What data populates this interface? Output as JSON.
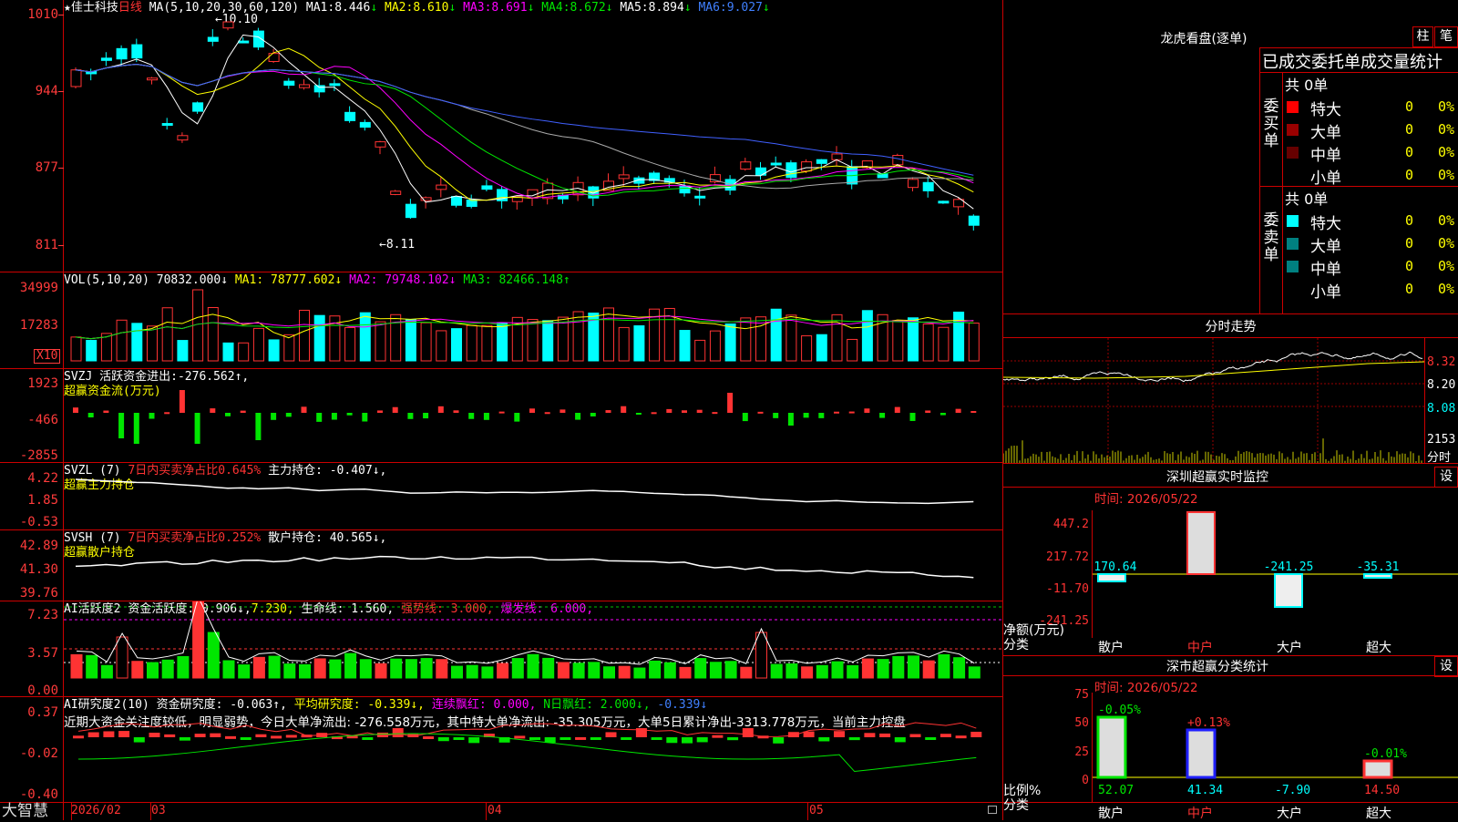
{
  "colors": {
    "up": "#ff3333",
    "down": "#00ffff",
    "bg": "#000000",
    "grid": "#cc0000"
  },
  "kline": {
    "stock": "佳士科技",
    "period": "日线",
    "ma_label": "MA(5,10,20,30,60,120)",
    "ma": [
      {
        "name": "MA1:",
        "value": "8.446",
        "arrow": "↓"
      },
      {
        "name": "MA2:",
        "value": "8.610",
        "arrow": "↓"
      },
      {
        "name": "MA3:",
        "value": "8.691",
        "arrow": "↓"
      },
      {
        "name": "MA4:",
        "value": "8.672",
        "arrow": "↓"
      },
      {
        "name": "MA5:",
        "value": "8.894",
        "arrow": "↓"
      },
      {
        "name": "MA6:",
        "value": "9.027",
        "arrow": "↓"
      }
    ],
    "y_labels": [
      "1010",
      "944",
      "877",
      "811"
    ],
    "high_note": "10.10",
    "low_note": "8.11"
  },
  "vol": {
    "title": "VOL(5,10,20)",
    "value": "70832.000↓",
    "ma1": "MA1: 78777.602↓",
    "ma2": "MA2: 79748.102↓",
    "ma3": "MA3: 82466.148↑",
    "y_labels": [
      "34999",
      "17283"
    ],
    "unit": "X10"
  },
  "svzj": {
    "line1": "SVZJ  活跃资金进出:",
    "value": "-276.562↑,",
    "sub": "超赢资金流(万元)",
    "y_labels": [
      "1923",
      "-466",
      "-2855"
    ]
  },
  "svzl": {
    "label": "SVZL (7)",
    "ratio": "7日内买卖净占比0.645%",
    "main": "主力持仓: -0.407↓,",
    "sub": "超赢主力持仓",
    "y_labels": [
      "4.22",
      "1.85",
      "-0.53"
    ]
  },
  "svsh": {
    "label": "SVSH (7)",
    "ratio": "7日内买卖净占比0.252%",
    "main": "散户持仓: 40.565↓,",
    "sub": "超赢散户持仓",
    "y_labels": [
      "42.89",
      "41.30",
      "39.76"
    ]
  },
  "ai_active": {
    "label": "AI活跃度2",
    "a": "资金活跃度: 0.906↓,",
    "b": "7.230,",
    "c": "生命线: 1.560,",
    "d": "强势线: 3.000,",
    "e": "爆发线: 6.000,",
    "y_labels": [
      "7.23",
      "3.57",
      "0.00"
    ]
  },
  "ai_research": {
    "label": "AI研究度2(10)",
    "a": "资金研究度: -0.063↑,",
    "b": "平均研究度: -0.339↓,",
    "c": "连续飘红: 0.000,",
    "d": "N日飘红: 2.000↓,",
    "e": "-0.339↓",
    "comment": "近期大资金关注度较低，明显弱势，今日大单净流出: -276.558万元，其中特大单净流出: -35.305万元，大单5日累计净出-3313.778万元，当前主力控盘",
    "y_labels": [
      "0.37",
      "-0.02",
      "-0.40"
    ]
  },
  "x_axis": {
    "brand": "大智慧",
    "labels": [
      "2026/02",
      "03",
      "04",
      "05"
    ]
  },
  "right": {
    "lhb_title": "龙虎看盘(逐单)",
    "btn1": "柱",
    "btn2": "笔",
    "order_title": "已成交委托单成交量统计",
    "buy_label": "委买单",
    "sell_label": "委卖单",
    "buy_total": "共 0单",
    "sell_total": "共 0单",
    "buy_rows": [
      {
        "name": "特大",
        "count": "0",
        "pct": "0%",
        "color": "#ff0000"
      },
      {
        "name": "大单",
        "count": "0",
        "pct": "0%",
        "color": "#990000"
      },
      {
        "name": "中单",
        "count": "0",
        "pct": "0%",
        "color": "#660000"
      },
      {
        "name": "小单",
        "count": "0",
        "pct": "0%",
        "color": ""
      }
    ],
    "sell_rows": [
      {
        "name": "特大",
        "count": "0",
        "pct": "0%",
        "color": "#00ffff"
      },
      {
        "name": "大单",
        "count": "0",
        "pct": "0%",
        "color": "#008080"
      },
      {
        "name": "中单",
        "count": "0",
        "pct": "0%",
        "color": "#008080"
      },
      {
        "name": "小单",
        "count": "0",
        "pct": "0%",
        "color": ""
      }
    ],
    "intraday_title": "分时走势",
    "intraday_y": [
      "8.32",
      "8.20",
      "8.08"
    ],
    "intraday_vol": "2153",
    "intraday_vol_unit": "分时",
    "sz_monitor": {
      "title": "深圳超赢实时监控",
      "set": "设",
      "time": "时间: 2026/05/22",
      "y_labels": [
        "447.2",
        "217.72",
        "-11.70",
        "-241.25"
      ],
      "net_label": "净额(万元)",
      "cat_label": "分类",
      "categories": [
        "散户",
        "中户",
        "大户",
        "超大"
      ],
      "values": [
        "-170.64",
        "447.2",
        "-241.25",
        "-35.31"
      ]
    },
    "sz_class": {
      "title": "深市超赢分类统计",
      "set": "设",
      "time": "时间: 2026/05/22",
      "y_labels": [
        "75",
        "50",
        "25",
        "0"
      ],
      "ratio_label": "比例%",
      "cat_label": "分类",
      "categories": [
        "散户",
        "中户",
        "大户",
        "超大"
      ],
      "pct_top": [
        "-0.05%",
        "+0.13%",
        "",
        "-0.01%"
      ],
      "values": [
        "52.07",
        "41.34",
        "-7.90",
        "14.50"
      ]
    }
  }
}
